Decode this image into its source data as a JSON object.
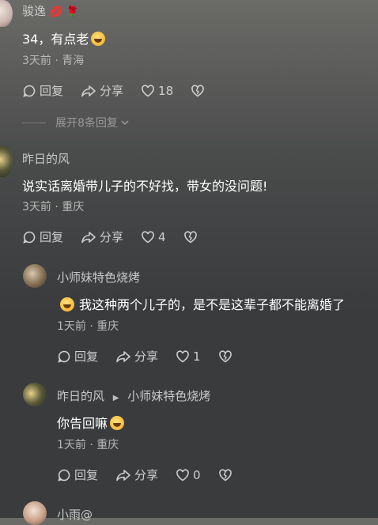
{
  "comments": [
    {
      "author": "骏逸",
      "content": "34，有点老",
      "meta": "3天前 · 青海",
      "reply_label": "回复",
      "share_label": "分享",
      "likes": "18"
    },
    {
      "author": "昨日的风",
      "content": "说实话离婚带儿子的不好找，带女的没问题!",
      "meta": "3天前 · 重庆",
      "reply_label": "回复",
      "share_label": "分享",
      "likes": "4"
    }
  ],
  "expand_replies": "展开8条回复",
  "replies": [
    {
      "author": "小师妹特色烧烤",
      "content": "我这种两个儿子的，是不是这辈子都不能离婚了",
      "meta": "1天前 · 重庆",
      "reply_label": "回复",
      "share_label": "分享",
      "likes": "1"
    },
    {
      "author": "昨日的风",
      "reply_to": "小师妹特色烧烤",
      "content": "你告回嘛",
      "meta": "1天前 · 重庆",
      "reply_label": "回复",
      "share_label": "分享",
      "likes": "0"
    },
    {
      "author": "小雨@"
    }
  ],
  "colors": {
    "text": "#ffffff",
    "muted": "#b8b8b8",
    "accent_heart": "#e0245e"
  }
}
